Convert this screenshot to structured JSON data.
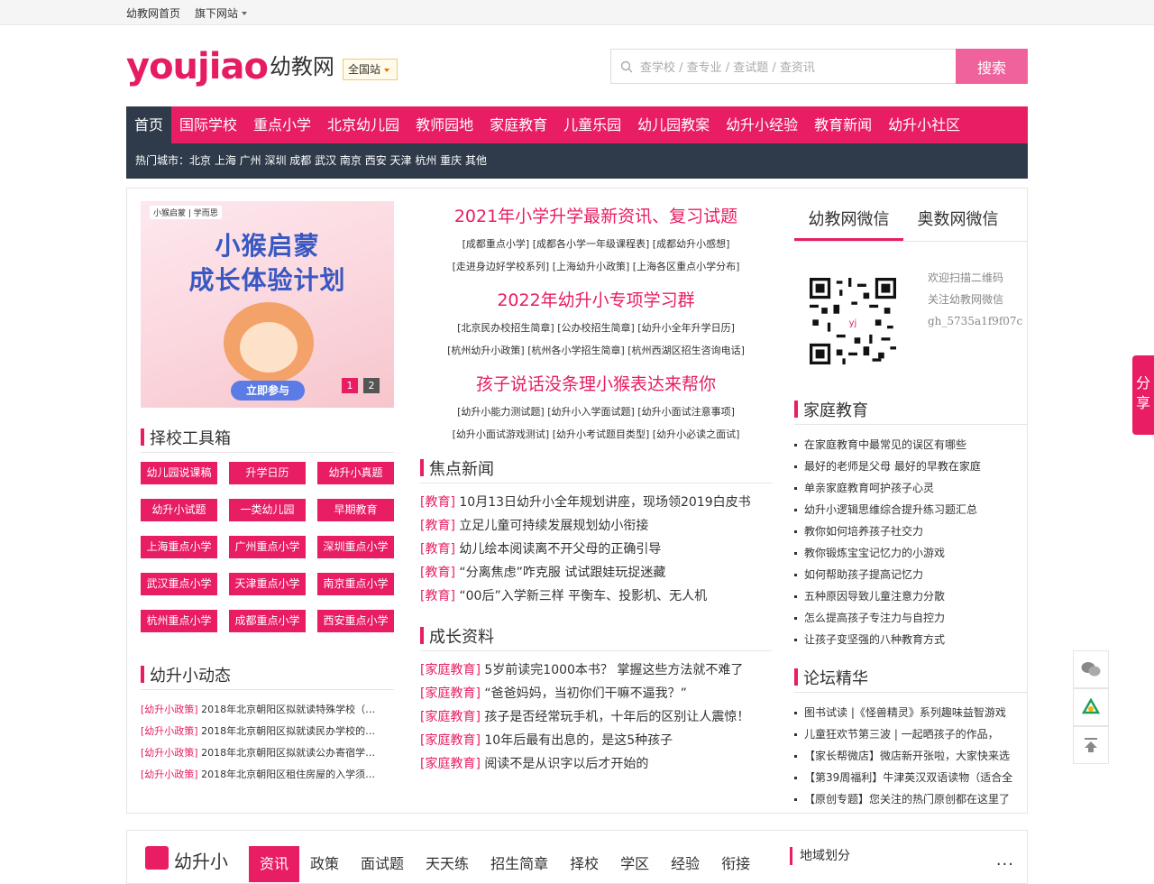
{
  "topbar": {
    "home": "幼教网首页",
    "sites": "旗下网站"
  },
  "logo": {
    "latin_a": "you",
    "latin_b": "jiao",
    "cn": "幼教网"
  },
  "station": "全国站",
  "search": {
    "placeholder": "查学校 / 查专业 / 查试题 / 查资讯",
    "button": "搜索"
  },
  "nav": [
    "首页",
    "国际学校",
    "重点小学",
    "北京幼儿园",
    "教师园地",
    "家庭教育",
    "儿童乐园",
    "幼儿园教案",
    "幼升小经验",
    "教育新闻",
    "幼升小社区"
  ],
  "hot": {
    "label": "热门城市：",
    "cities": "北京 上海 广州 深圳 成都 武汉 南京 西安 天津 杭州 重庆 其他"
  },
  "banner": {
    "brand": "小猴启蒙 | 学而思",
    "line1": "小猴启蒙",
    "line2": "成长体验计划",
    "cta": "立即参与",
    "dots": [
      "1",
      "2"
    ]
  },
  "tools": {
    "title": "择校工具箱",
    "items": [
      "幼儿园说课稿",
      "升学日历",
      "幼升小真题",
      "幼升小试题",
      "一类幼儿园",
      "早期教育",
      "上海重点小学",
      "广州重点小学",
      "深圳重点小学",
      "武汉重点小学",
      "天津重点小学",
      "南京重点小学",
      "杭州重点小学",
      "成都重点小学",
      "西安重点小学"
    ]
  },
  "dynamics": {
    "title": "幼升小动态",
    "tag": "[幼升小政策]",
    "items": [
      "2018年北京朝阳区拟就读特殊学校（…",
      "2018年北京朝阳区拟就读民办学校的…",
      "2018年北京朝阳区拟就读公办寄宿学…",
      "2018年北京朝阳区租住房屋的入学须…"
    ]
  },
  "mid": {
    "h1": "2021年小学升学最新资讯、复习试题",
    "l1a": "[成都重点小学] [成都各小学一年级课程表] [成都幼升小感想]",
    "l1b": "[走进身边好学校系列] [上海幼升小政策] [上海各区重点小学分布]",
    "h2": "2022年幼升小专项学习群",
    "l2a": "[北京民办校招生简章] [公办校招生简章] [幼升小全年升学日历]",
    "l2b": "[杭州幼升小政策] [杭州各小学招生简章] [杭州西湖区招生咨询电话]",
    "h3": "孩子说话没条理小猴表达来帮你",
    "l3a": "[幼升小能力测试题] [幼升小入学面试题] [幼升小面试注意事项]",
    "l3b": "[幼升小面试游戏测试] [幼升小考试题目类型] [幼升小必读之面试]"
  },
  "focus": {
    "title": "焦点新闻",
    "tag": "[教育]",
    "items": [
      "10月13日幼升小全年规划讲座，现场领2019白皮书",
      "立足儿童可持续发展规划幼小衔接",
      "幼儿绘本阅读离不开父母的正确引导",
      "“分离焦虑”咋克服 试试跟娃玩捉迷藏",
      "“00后”入学新三样 平衡车、投影机、无人机"
    ]
  },
  "growth": {
    "title": "成长资料",
    "tag": "[家庭教育]",
    "items": [
      "5岁前读完1000本书？ 掌握这些方法就不难了",
      "“爸爸妈妈，当初你们干嘛不逼我？”",
      "孩子是否经常玩手机，十年后的区别让人震惊！",
      "10年后最有出息的，是这5种孩子",
      "阅读不是从识字以后才开始的"
    ]
  },
  "wechat": {
    "tab1": "幼教网微信",
    "tab2": "奥数网微信",
    "line1": "欢迎扫描二维码",
    "line2": "关注幼教网微信",
    "line3": "gh_5735a1f9f07c"
  },
  "family": {
    "title": "家庭教育",
    "items": [
      "在家庭教育中最常见的误区有哪些",
      "最好的老师是父母 最好的早教在家庭",
      "单亲家庭教育呵护孩子心灵",
      "幼升小逻辑思维综合提升练习题汇总",
      "教你如何培养孩子社交力",
      "教你锻炼宝宝记忆力的小游戏",
      "如何帮助孩子提高记忆力",
      "五种原因导致儿童注意力分散",
      "怎么提高孩子专注力与自控力",
      "让孩子变坚强的八种教育方式"
    ]
  },
  "forum": {
    "title": "论坛精华",
    "items": [
      "图书试读 |《怪兽精灵》系列趣味益智游戏",
      "儿童狂欢节第三波 | 一起晒孩子的作品，",
      "【家长帮微店】微店新开张啦，大家快来选",
      "【第39周福利】牛津英汉双语读物（适合全",
      "【原创专题】您关注的热门原创都在这里了"
    ]
  },
  "bottom": {
    "label": "幼升小",
    "tabs": [
      "资讯",
      "政策",
      "面试题",
      "天天练",
      "招生简章",
      "择校",
      "学区",
      "经验",
      "衔接"
    ],
    "region": "地域划分",
    "more": "..."
  },
  "share": "分享"
}
